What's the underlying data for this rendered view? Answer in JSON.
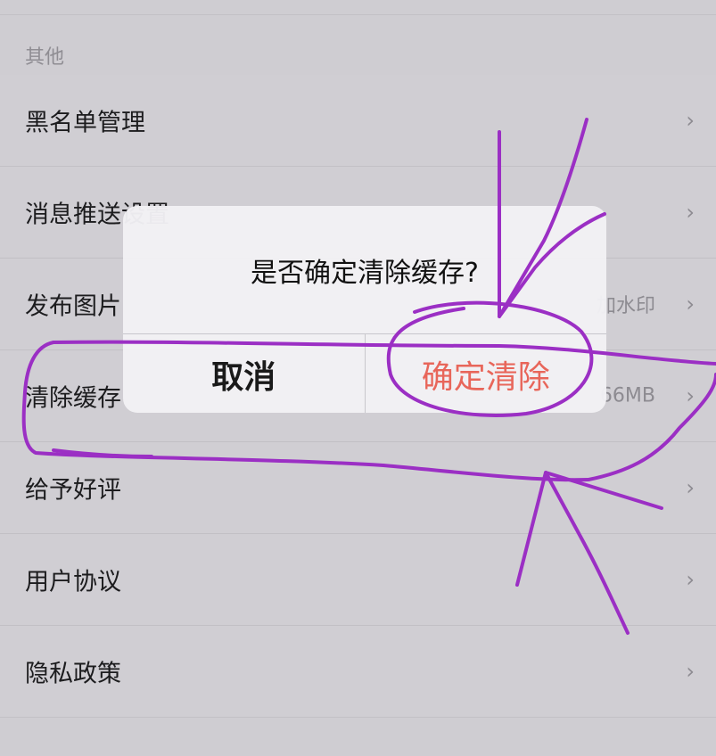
{
  "section": {
    "header": "其他"
  },
  "rows": [
    {
      "label": "黑名单管理",
      "value": ""
    },
    {
      "label": "消息推送设置",
      "value": ""
    },
    {
      "label": "发布图片",
      "value": "加水印"
    },
    {
      "label": "清除缓存",
      "value": "66MB"
    },
    {
      "label": "给予好评",
      "value": ""
    },
    {
      "label": "用户协议",
      "value": ""
    },
    {
      "label": "隐私政策",
      "value": ""
    }
  ],
  "dialog": {
    "title": "是否确定清除缓存?",
    "cancel_label": "取消",
    "confirm_label": "确定清除"
  },
  "icons": {
    "chevron": "›"
  },
  "colors": {
    "confirm": "#e8665a",
    "annotation": "#9b2fc4"
  }
}
